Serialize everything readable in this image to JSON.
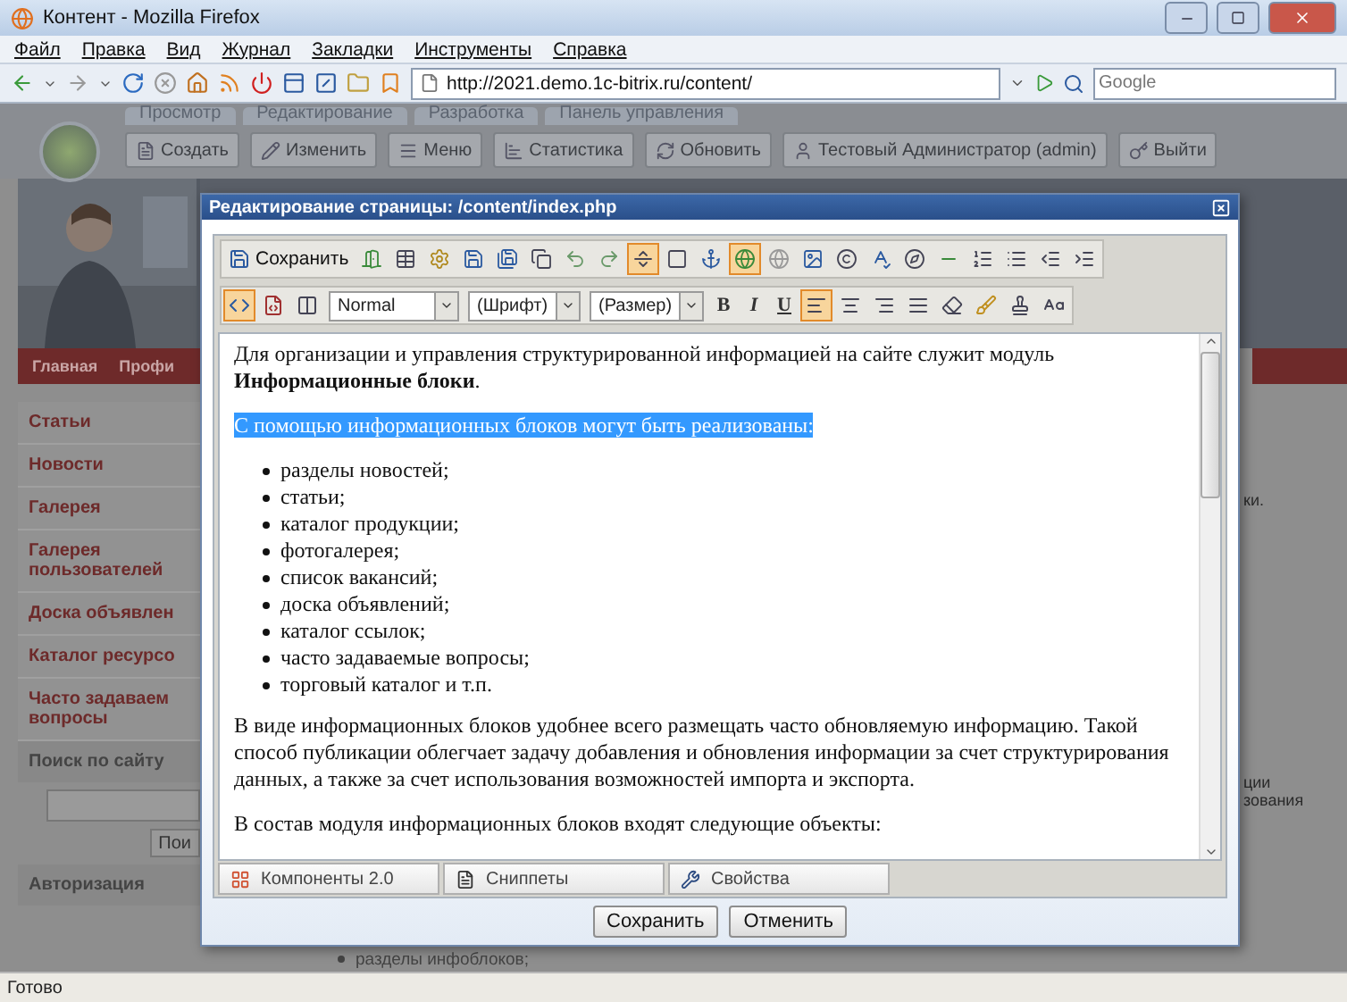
{
  "window": {
    "title": "Контент - Mozilla Firefox"
  },
  "menu": [
    "Файл",
    "Правка",
    "Вид",
    "Журнал",
    "Закладки",
    "Инструменты",
    "Справка"
  ],
  "address": {
    "value": "http://2021.demo.1c-bitrix.ru/content/"
  },
  "search": {
    "placeholder": "Google"
  },
  "admin_panel": {
    "tabs": [
      "Просмотр",
      "Редактирование",
      "Разработка",
      "Панель управления"
    ],
    "buttons": [
      "Создать",
      "Изменить",
      "Меню",
      "Статистика",
      "Обновить",
      "Тестовый Администратор (admin)",
      "Выйти"
    ]
  },
  "site": {
    "nav": [
      "Главная",
      "Профи"
    ],
    "sidebar": [
      "Статьи",
      "Новости",
      "Галерея",
      "Галерея пользователей",
      "Доска объявлен",
      "Каталог ресурсо",
      "Часто задаваем вопросы"
    ],
    "search_title": "Поиск по сайту",
    "search_button": "Пои",
    "auth_title": "Авторизация",
    "right_texts": [
      "ки.",
      "ции",
      "зования"
    ],
    "below_bullet": "разделы инфоблоков;"
  },
  "dialog": {
    "title": "Редактирование страницы: /content/index.php",
    "toolbar_row_1": {
      "save_label": "Сохранить",
      "buttons": [
        {
          "on": false
        },
        {
          "on": false
        },
        {
          "on": false
        },
        {
          "on": false
        },
        {
          "on": false
        },
        {
          "on": false
        },
        {
          "on": false
        },
        {
          "on": false
        },
        {
          "on": true
        },
        {
          "on": false
        },
        {
          "on": false
        },
        {
          "on": true
        },
        {
          "on": false
        },
        {
          "on": false
        },
        {
          "on": false
        },
        {
          "on": false
        },
        {
          "on": false
        },
        {
          "on": false
        },
        {
          "on": false
        },
        {
          "on": false
        },
        {
          "on": false
        },
        {
          "on": false
        }
      ]
    },
    "toolbar_row_2": {
      "mode_buttons": [
        {
          "on": true
        },
        {
          "on": false
        },
        {
          "on": false
        }
      ],
      "dropdowns": [
        "Normal",
        "(Шрифт)",
        "(Размер)"
      ],
      "format_buttons": [
        "B",
        "I",
        "U"
      ],
      "align_buttons": [
        {
          "on": true
        },
        {
          "on": false
        },
        {
          "on": false
        },
        {
          "on": false
        }
      ]
    },
    "content": [
      {
        "kind": "paragraph",
        "selected": false,
        "text": "Для организации и управления структурированной информацией на сайте служит модуль **Информационные блоки**."
      },
      {
        "kind": "paragraph",
        "selected": true,
        "text": "С помощью информационных блоков могут быть реализованы:"
      },
      {
        "kind": "list",
        "items": [
          "разделы новостей;",
          "статьи;",
          "каталог продукции;",
          "фотогалерея;",
          "список вакансий;",
          "доска объявлений;",
          "каталог ссылок;",
          "часто задаваемые вопросы;",
          "торговый каталог и т.п."
        ]
      },
      {
        "kind": "paragraph",
        "selected": false,
        "text": "В виде информационных блоков удобнее всего размещать часто обновляемую информацию. Такой способ публикации облегчает задачу добавления и обновления информации за счет структурирования данных, а также за счет использования возможностей импорта и экспорта."
      },
      {
        "kind": "paragraph",
        "selected": false,
        "text": "В состав модуля информационных блоков входят следующие объекты:"
      }
    ],
    "tabs": [
      "Компоненты 2.0",
      "Сниппеты",
      "Свойства"
    ],
    "buttons": [
      "Сохранить",
      "Отменить"
    ]
  },
  "status_bar": "Готово"
}
